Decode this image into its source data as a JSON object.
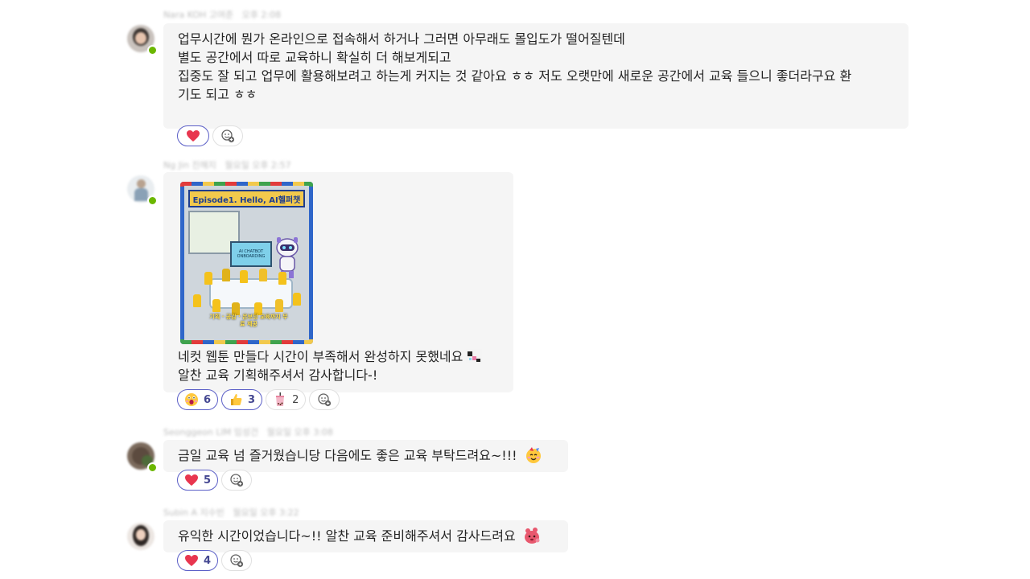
{
  "messages": [
    {
      "author": "Nara KOH 고여준",
      "time": "오후 2:08",
      "lines": [
        "업무시간에 뭔가 온라인으로 접속해서 하거나 그러면 아무래도 몰입도가 떨어질텐데",
        "",
        "별도 공간에서 따로 교육하니 확실히 더 해보게되고",
        "집중도 잘 되고 업무에 활용해보려고 하는게 커지는 것 같아요 ㅎㅎ 저도 오랫만에 새로운 공간에서 교육 들으니 좋더라구요 환",
        "기도 되고 ㅎㅎ"
      ],
      "reactions": [
        {
          "emoji": "heart-emoji",
          "count": "",
          "mine": true
        }
      ]
    },
    {
      "author": "Ng Jin 진해지",
      "time": "월요일 오후 2:57",
      "image": {
        "title": "Episode1. Hello, AI헬퍼챗",
        "screen_text": "AI CHATBOT ONBOARDING",
        "caption": "기획 · 공감 · 온보딩 교육까지 무료 제공"
      },
      "lines": [
        "네컷 웹툰 만들다 시간이 부족해서 완성하지 못했네요",
        "알찬 교육 기획해주셔서 감사합니다-!"
      ],
      "reactions": [
        {
          "emoji": "astonished-face-emoji",
          "count": "6",
          "mine": true
        },
        {
          "emoji": "thumbs-up-emoji",
          "count": "3",
          "mine": true
        },
        {
          "emoji": "bubble-tea-emoji",
          "count": "2",
          "mine": false
        }
      ]
    },
    {
      "author": "Seonggeon LIM 임성건",
      "time": "월요일 오후 3:08",
      "lines": [
        "금일 교육 넘 즐거웠습니당 다음에도 좋은 교육 부탁드려요~!!! "
      ],
      "reactions": [
        {
          "emoji": "heart-emoji",
          "count": "5",
          "mine": true
        }
      ]
    },
    {
      "author": "Subin A 지수빈",
      "time": "월요일 오후 3:22",
      "lines": [
        "유익한 시간이었습니다~!! 알찬 교육 준비해주셔서 감사드려요 "
      ],
      "reactions": [
        {
          "emoji": "heart-emoji",
          "count": "4",
          "mine": true
        }
      ]
    }
  ],
  "add_reaction_icon": "add-reaction-icon",
  "colors": {
    "bubble": "#f5f5f5",
    "accent": "#5b5fc7",
    "presence": "#6bb700",
    "heart": "#e8364f"
  }
}
